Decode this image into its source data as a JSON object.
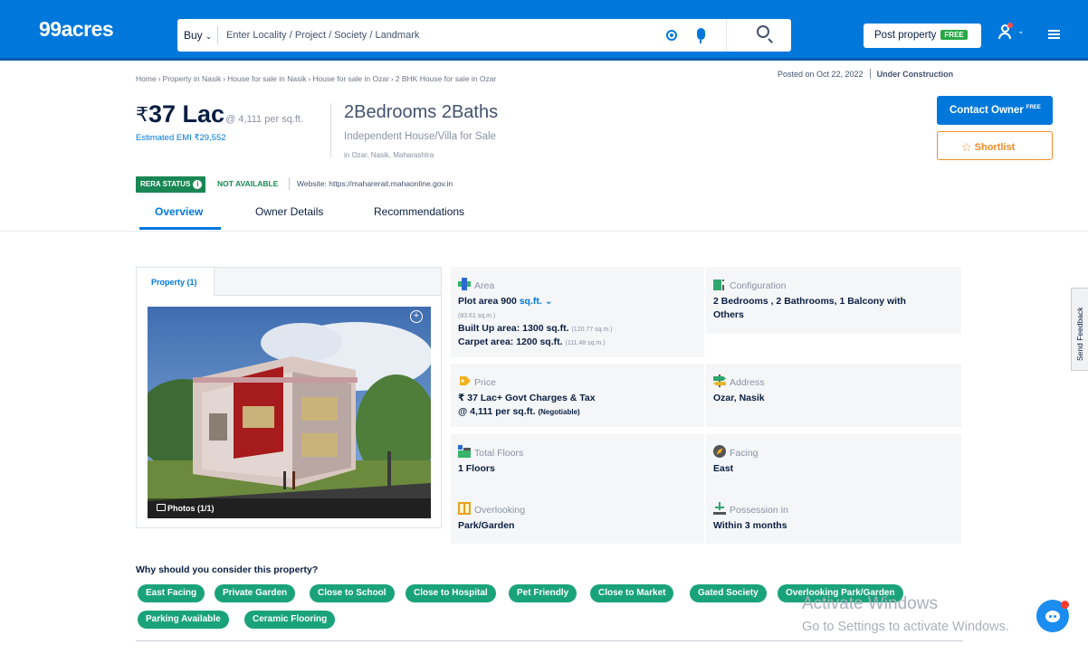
{
  "header": {
    "logo": "99acres",
    "buy_label": "Buy",
    "search_placeholder": "Enter Locality / Project / Society / Landmark",
    "post_property": "Post property",
    "free_tag": "FREE"
  },
  "breadcrumb": [
    "Home",
    "Property in Nasik",
    "House for sale in Nasik",
    "House for sale in Ozar",
    "2 BHK House for sale in Ozar"
  ],
  "breadcrumb_sep": "›",
  "meta": {
    "posted": "Posted on Oct 22, 2022",
    "status": "Under Construction"
  },
  "price": {
    "currency": "₹",
    "amount": "37 Lac",
    "per_sqft": "@ 4,111 per sq.ft.",
    "emi": "Estimated EMI ₹29,552"
  },
  "listing": {
    "title": "2Bedrooms 2Baths",
    "subtitle": "Independent House/Villa for Sale",
    "locality": "in Ozar, Nasik, Maharashtra"
  },
  "actions": {
    "contact": "Contact Owner",
    "contact_tag": "FREE",
    "shortlist": "Shortlist"
  },
  "rera": {
    "label": "RERA STATUS",
    "status": "NOT AVAILABLE",
    "website": "Website: https://maharerait.mahaonline.gov.in"
  },
  "tabs": [
    "Overview",
    "Owner Details",
    "Recommendations"
  ],
  "photo_card": {
    "tab": "Property (1)",
    "photos_label": "Photos (1/1)"
  },
  "details": {
    "area": {
      "label": "Area",
      "plot_prefix": "Plot area 900",
      "plot_unit": "sq.ft.",
      "plot_sqm": "(83.61 sq.m.)",
      "builtup": "Built Up area: 1300 sq.ft.",
      "builtup_sqm": "(120.77 sq.m.)",
      "carpet": "Carpet area: 1200 sq.ft.",
      "carpet_sqm": "(111.48 sq.m.)"
    },
    "configuration": {
      "label": "Configuration",
      "line1": "2 Bedrooms , 2 Bathrooms, 1 Balcony with",
      "line2": "Others"
    },
    "price": {
      "label": "Price",
      "line1": "₹ 37 Lac+ Govt Charges & Tax",
      "line2": "@ 4,111 per sq.ft.",
      "line2_note": "(Negotiable)"
    },
    "address": {
      "label": "Address",
      "value": "Ozar, Nasik"
    },
    "floors": {
      "label": "Total Floors",
      "value": "1 Floors"
    },
    "facing": {
      "label": "Facing",
      "value": "East"
    },
    "overlooking": {
      "label": "Overlooking",
      "value": "Park/Garden"
    },
    "possession": {
      "label": "Possession in",
      "value": "Within 3 months"
    }
  },
  "reasons": {
    "title": "Why should you consider this property?",
    "chips": [
      "East Facing",
      "Private Garden",
      "Close to School",
      "Close to Hospital",
      "Pet Friendly",
      "Close to Market",
      "Gated Society",
      "Overlooking Park/Garden",
      "Parking Available",
      "Ceramic Flooring"
    ]
  },
  "feedback": "Send Feedback",
  "watermark": {
    "line1": "Activate Windows",
    "line2": "Go to Settings to activate Windows."
  },
  "colors": {
    "brand": "#0078db",
    "rera_green": "#198754",
    "chip_green": "#1aa37a",
    "shortlist_orange": "#f08c2b"
  }
}
